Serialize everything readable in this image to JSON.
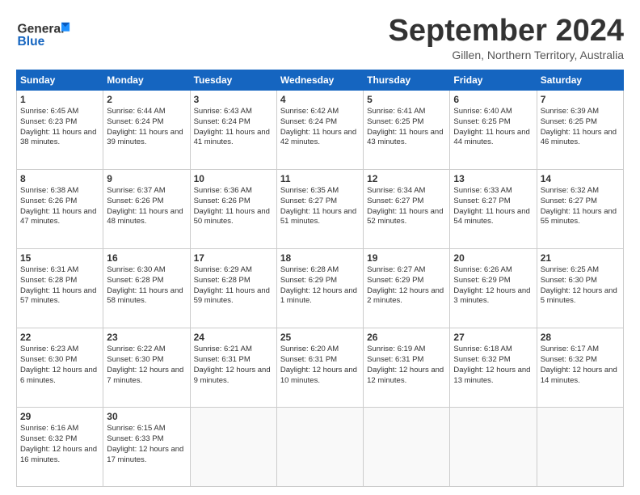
{
  "logo": {
    "general": "General",
    "blue": "Blue"
  },
  "header": {
    "month": "September 2024",
    "location": "Gillen, Northern Territory, Australia"
  },
  "weekdays": [
    "Sunday",
    "Monday",
    "Tuesday",
    "Wednesday",
    "Thursday",
    "Friday",
    "Saturday"
  ],
  "weeks": [
    [
      {
        "day": "1",
        "sunrise": "6:45 AM",
        "sunset": "6:23 PM",
        "daylight": "11 hours and 38 minutes."
      },
      {
        "day": "2",
        "sunrise": "6:44 AM",
        "sunset": "6:24 PM",
        "daylight": "11 hours and 39 minutes."
      },
      {
        "day": "3",
        "sunrise": "6:43 AM",
        "sunset": "6:24 PM",
        "daylight": "11 hours and 41 minutes."
      },
      {
        "day": "4",
        "sunrise": "6:42 AM",
        "sunset": "6:24 PM",
        "daylight": "11 hours and 42 minutes."
      },
      {
        "day": "5",
        "sunrise": "6:41 AM",
        "sunset": "6:25 PM",
        "daylight": "11 hours and 43 minutes."
      },
      {
        "day": "6",
        "sunrise": "6:40 AM",
        "sunset": "6:25 PM",
        "daylight": "11 hours and 44 minutes."
      },
      {
        "day": "7",
        "sunrise": "6:39 AM",
        "sunset": "6:25 PM",
        "daylight": "11 hours and 46 minutes."
      }
    ],
    [
      {
        "day": "8",
        "sunrise": "6:38 AM",
        "sunset": "6:26 PM",
        "daylight": "11 hours and 47 minutes."
      },
      {
        "day": "9",
        "sunrise": "6:37 AM",
        "sunset": "6:26 PM",
        "daylight": "11 hours and 48 minutes."
      },
      {
        "day": "10",
        "sunrise": "6:36 AM",
        "sunset": "6:26 PM",
        "daylight": "11 hours and 50 minutes."
      },
      {
        "day": "11",
        "sunrise": "6:35 AM",
        "sunset": "6:27 PM",
        "daylight": "11 hours and 51 minutes."
      },
      {
        "day": "12",
        "sunrise": "6:34 AM",
        "sunset": "6:27 PM",
        "daylight": "11 hours and 52 minutes."
      },
      {
        "day": "13",
        "sunrise": "6:33 AM",
        "sunset": "6:27 PM",
        "daylight": "11 hours and 54 minutes."
      },
      {
        "day": "14",
        "sunrise": "6:32 AM",
        "sunset": "6:27 PM",
        "daylight": "11 hours and 55 minutes."
      }
    ],
    [
      {
        "day": "15",
        "sunrise": "6:31 AM",
        "sunset": "6:28 PM",
        "daylight": "11 hours and 57 minutes."
      },
      {
        "day": "16",
        "sunrise": "6:30 AM",
        "sunset": "6:28 PM",
        "daylight": "11 hours and 58 minutes."
      },
      {
        "day": "17",
        "sunrise": "6:29 AM",
        "sunset": "6:28 PM",
        "daylight": "11 hours and 59 minutes."
      },
      {
        "day": "18",
        "sunrise": "6:28 AM",
        "sunset": "6:29 PM",
        "daylight": "12 hours and 1 minute."
      },
      {
        "day": "19",
        "sunrise": "6:27 AM",
        "sunset": "6:29 PM",
        "daylight": "12 hours and 2 minutes."
      },
      {
        "day": "20",
        "sunrise": "6:26 AM",
        "sunset": "6:29 PM",
        "daylight": "12 hours and 3 minutes."
      },
      {
        "day": "21",
        "sunrise": "6:25 AM",
        "sunset": "6:30 PM",
        "daylight": "12 hours and 5 minutes."
      }
    ],
    [
      {
        "day": "22",
        "sunrise": "6:23 AM",
        "sunset": "6:30 PM",
        "daylight": "12 hours and 6 minutes."
      },
      {
        "day": "23",
        "sunrise": "6:22 AM",
        "sunset": "6:30 PM",
        "daylight": "12 hours and 7 minutes."
      },
      {
        "day": "24",
        "sunrise": "6:21 AM",
        "sunset": "6:31 PM",
        "daylight": "12 hours and 9 minutes."
      },
      {
        "day": "25",
        "sunrise": "6:20 AM",
        "sunset": "6:31 PM",
        "daylight": "12 hours and 10 minutes."
      },
      {
        "day": "26",
        "sunrise": "6:19 AM",
        "sunset": "6:31 PM",
        "daylight": "12 hours and 12 minutes."
      },
      {
        "day": "27",
        "sunrise": "6:18 AM",
        "sunset": "6:32 PM",
        "daylight": "12 hours and 13 minutes."
      },
      {
        "day": "28",
        "sunrise": "6:17 AM",
        "sunset": "6:32 PM",
        "daylight": "12 hours and 14 minutes."
      }
    ],
    [
      {
        "day": "29",
        "sunrise": "6:16 AM",
        "sunset": "6:32 PM",
        "daylight": "12 hours and 16 minutes."
      },
      {
        "day": "30",
        "sunrise": "6:15 AM",
        "sunset": "6:33 PM",
        "daylight": "12 hours and 17 minutes."
      },
      null,
      null,
      null,
      null,
      null
    ]
  ]
}
